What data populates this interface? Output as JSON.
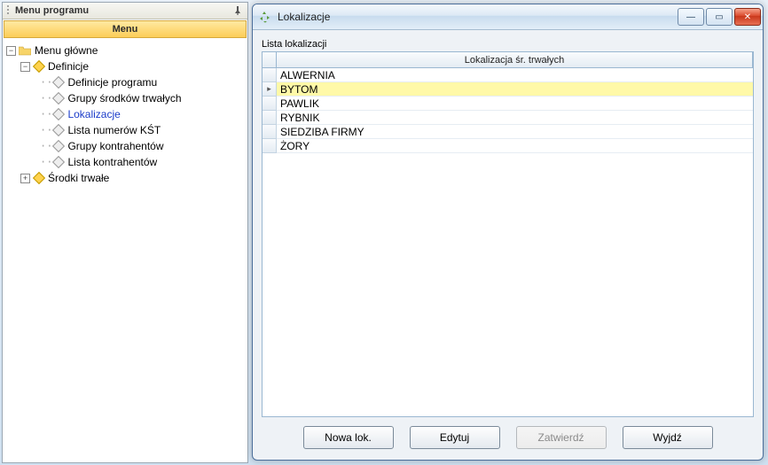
{
  "panelTitle": "Menu programu",
  "menuHeader": "Menu",
  "tree": {
    "root": "Menu główne",
    "definicje": "Definicje",
    "items": {
      "defProg": "Definicje programu",
      "grSr": "Grupy środków trwałych",
      "lokal": "Lokalizacje",
      "listaKst": "Lista numerów KŚT",
      "grKontr": "Grupy kontrahentów",
      "listaKontr": "Lista kontrahentów"
    },
    "srodki": "Środki trwałe"
  },
  "window": {
    "title": "Lokalizacje",
    "listLabel": "Lista lokalizacji",
    "columnHeader": "Lokalizacja śr. trwałych",
    "rows": [
      "ALWERNIA",
      "BYTOM",
      "PAWLIK",
      "RYBNIK",
      "SIEDZIBA FIRMY",
      "ŻORY"
    ],
    "selectedIndex": 1,
    "buttons": {
      "new": "Nowa lok.",
      "edit": "Edytuj",
      "ok": "Zatwierdź",
      "exit": "Wyjdź"
    }
  }
}
